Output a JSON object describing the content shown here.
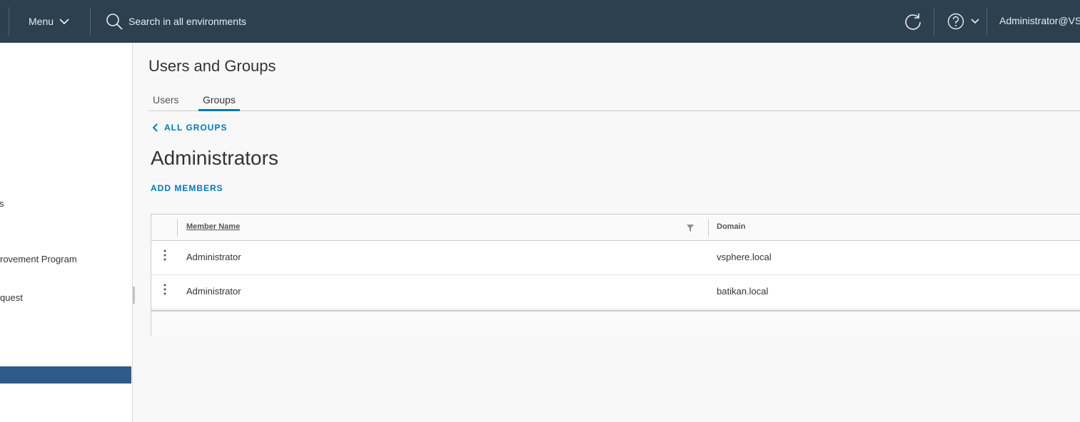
{
  "header": {
    "menu_label": "Menu",
    "search_placeholder": "Search in all environments",
    "user": "Administrator@VSPHERE.LOCAL",
    "bg_color": "#2d4050"
  },
  "sidebar": {
    "items": [
      {
        "label": "s",
        "active": false
      },
      {
        "label": "rovement Program",
        "active": false
      },
      {
        "label": "quest",
        "active": false
      },
      {
        "label": "",
        "active": true
      }
    ],
    "active_color": "#2e5b8a"
  },
  "main": {
    "page_title": "Users and Groups",
    "tabs": [
      {
        "label": "Users",
        "active": false
      },
      {
        "label": "Groups",
        "active": true
      }
    ],
    "back_link": "ALL GROUPS",
    "group_title": "Administrators",
    "add_members": "ADD MEMBERS",
    "accent_color": "#0079b8"
  },
  "grid": {
    "columns": [
      "Member Name",
      "Domain"
    ],
    "rows": [
      {
        "member_name": "Administrator",
        "domain": "vsphere.local"
      },
      {
        "member_name": "Administrator",
        "domain": "batikan.local"
      }
    ]
  }
}
